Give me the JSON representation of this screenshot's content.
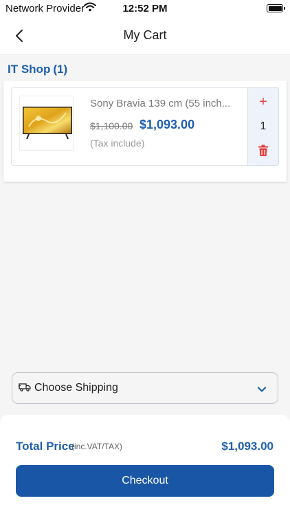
{
  "status_bar": {
    "carrier": "Network Provider",
    "time": "12:52 PM"
  },
  "nav": {
    "title": "My Cart"
  },
  "shop": {
    "name": "IT Shop",
    "count": "(1)"
  },
  "cart_items": [
    {
      "name": "Sony Bravia 139 cm (55 inch...",
      "old_price": "$1,100.00",
      "price": "$1,093.00",
      "tax_note": "(Tax include)",
      "quantity": "1",
      "plus_symbol": "+"
    }
  ],
  "shipping": {
    "label": "Choose Shipping"
  },
  "footer": {
    "total_label": "Total Price",
    "total_sub": "(inc.VAT/TAX)",
    "total_value": "$1,093.00",
    "checkout_label": "Checkout"
  },
  "icons": {
    "back": "chevron-left-icon",
    "wifi": "wifi-icon",
    "battery": "battery-icon",
    "delete": "trash-icon",
    "truck": "truck-icon",
    "dropdown": "chevron-down-icon"
  },
  "colors": {
    "accent": "#1f5fae",
    "button": "#1a56a6",
    "danger": "#e34141"
  }
}
